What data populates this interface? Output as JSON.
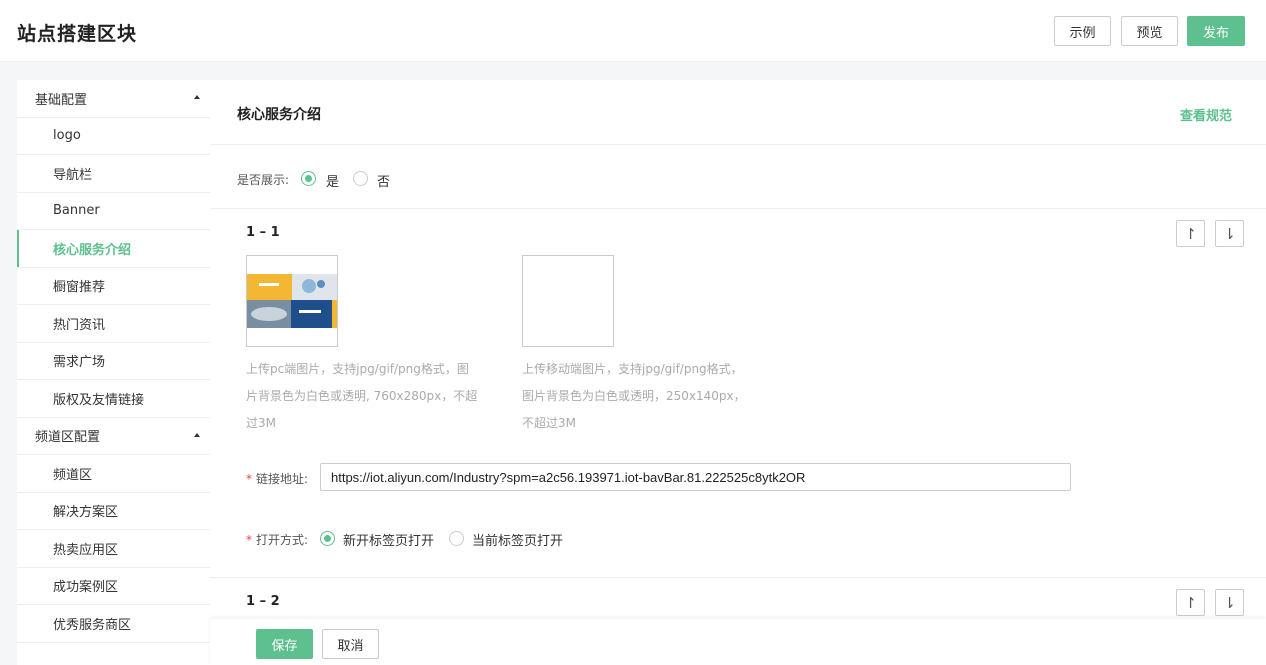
{
  "header": {
    "title": "站点搭建区块",
    "example_label": "示例",
    "preview_label": "预览",
    "publish_label": "发布"
  },
  "colors": {
    "accent": "#5ec08f",
    "required": "#e5484d"
  },
  "sidebar": {
    "groups": [
      {
        "label": "基础配置",
        "items": [
          "logo",
          "导航栏",
          "Banner",
          "核心服务介绍",
          "橱窗推荐",
          "热门资讯",
          "需求广场",
          "版权及友情链接"
        ]
      },
      {
        "label": "频道区配置",
        "items": [
          "频道区",
          "解决方案区",
          "热卖应用区",
          "成功案例区",
          "优秀服务商区"
        ]
      }
    ],
    "active_item": "核心服务介绍"
  },
  "panel": {
    "title": "核心服务介绍",
    "spec_link": "查看规范",
    "show_label": "是否展示:",
    "show_options": [
      "是",
      "否"
    ],
    "show_selected": "是"
  },
  "items": [
    {
      "title": "1 – 1",
      "up_icon": "arrow-up-icon",
      "down_icon": "arrow-down-icon",
      "pc_hint": [
        "上传pc端图片，支持jpg/gif/png格式，图",
        "片背景色为白色或透明, 760x280px，不超",
        "过3M"
      ],
      "mobile_hint": [
        "上传移动端图片，支持jpg/gif/png格式，",
        "图片背景色为白色或透明，250x140px，",
        "不超过3M"
      ],
      "link_label": "链接地址:",
      "link_value": "https://iot.aliyun.com/Industry?spm=a2c56.193971.iot-bavBar.81.222525c8ytk2OR",
      "open_label": "打开方式:",
      "open_options": [
        "新开标签页打开",
        "当前标签页打开"
      ],
      "open_selected": "新开标签页打开"
    },
    {
      "title": "1 – 2"
    }
  ],
  "footer": {
    "save_label": "保存",
    "cancel_label": "取消"
  }
}
